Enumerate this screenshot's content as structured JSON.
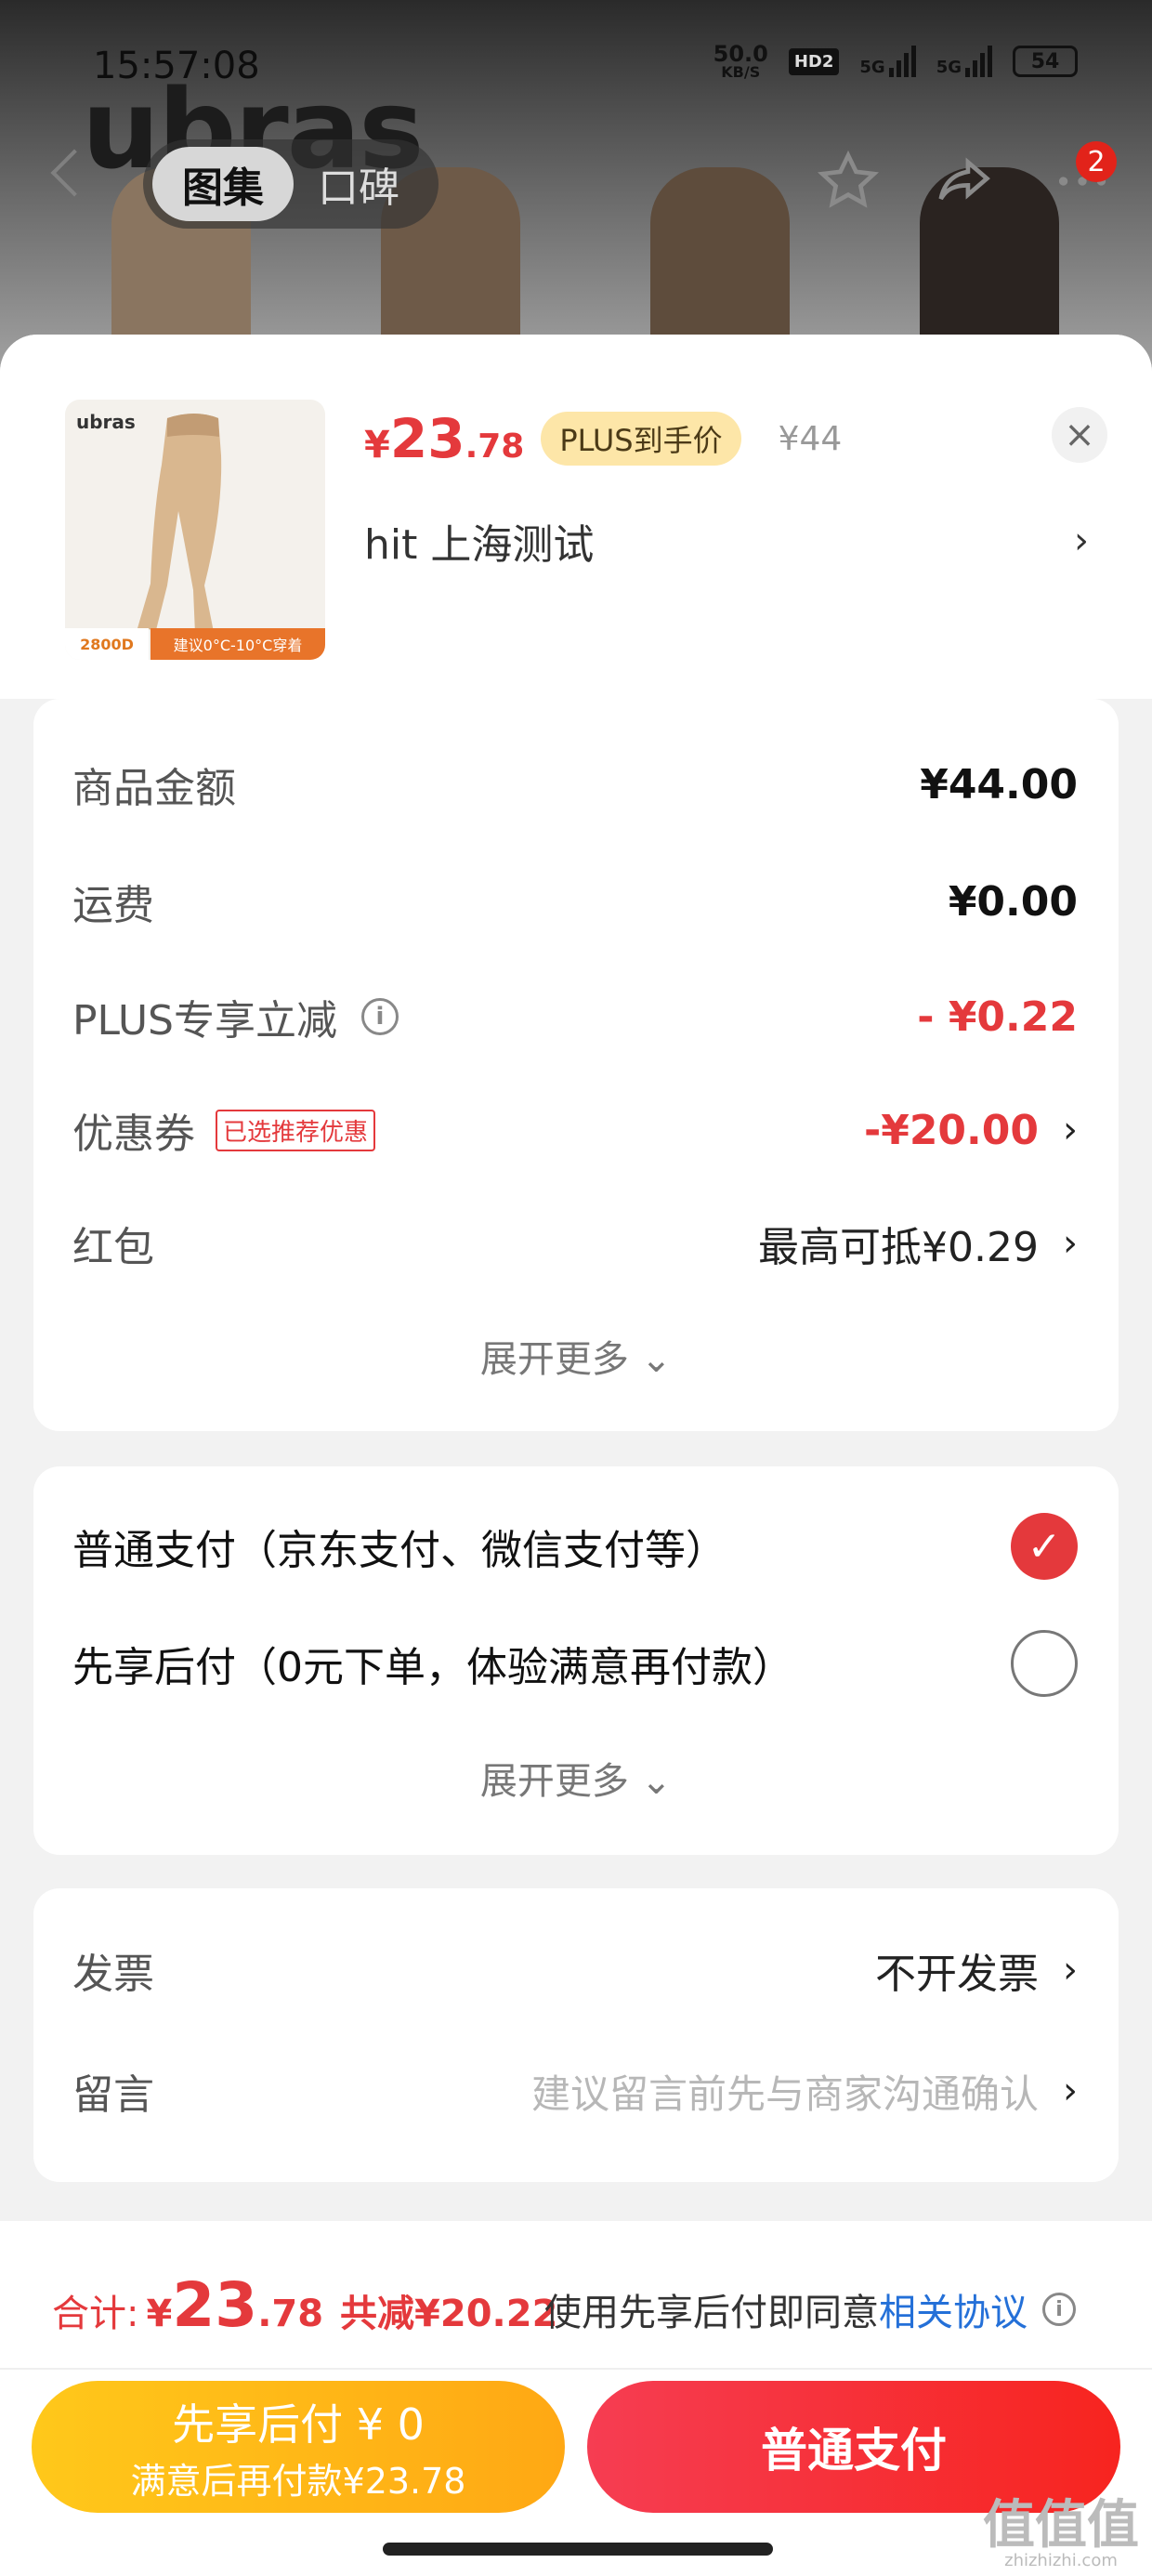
{
  "status_bar": {
    "time": "15:57:08",
    "net_speed": "50.0",
    "net_unit": "KB/S",
    "hd_label": "HD2",
    "sig1_label": "5G",
    "sig2_label": "5G",
    "battery": "54"
  },
  "background": {
    "brand": "ubras"
  },
  "nav": {
    "tab_gallery": "图集",
    "tab_reviews": "口碑",
    "cart_count": "2"
  },
  "product": {
    "image_brand": "ubras",
    "image_tag1": "2800D",
    "image_tag2": "建议0°C-10°C穿着",
    "price_currency": "¥",
    "price_int": "23",
    "price_dec": ".78",
    "plus_badge": "PLUS到手价",
    "original_price": "¥44",
    "spec": "hit  上海测试",
    "close_label": "×"
  },
  "cost_breakdown": {
    "items": [
      {
        "label": "商品金额",
        "value": "¥44.00"
      },
      {
        "label": "运费",
        "value": "¥0.00"
      },
      {
        "label": "PLUS专享立减",
        "value": "- ¥0.22"
      },
      {
        "label": "优惠券",
        "tag": "已选推荐优惠",
        "value": "-¥20.00"
      },
      {
        "label": "红包",
        "value": "最高可抵¥0.29"
      }
    ],
    "expand_label": "展开更多"
  },
  "payment": {
    "options": [
      {
        "label": "普通支付（京东支付、微信支付等）",
        "selected": true
      },
      {
        "label": "先享后付（0元下单，体验满意再付款）",
        "selected": false
      }
    ],
    "expand_label": "展开更多"
  },
  "extras": {
    "invoice_label": "发票",
    "invoice_value": "不开发票",
    "message_label": "留言",
    "message_placeholder": "建议留言前先与商家沟通确认"
  },
  "summary": {
    "total_label": "合计:",
    "currency": "¥",
    "total_int": "23",
    "total_dec": ".78",
    "saved": "共减¥20.22",
    "agree_text": "使用先享后付即同意",
    "agree_link": "相关协议"
  },
  "buttons": {
    "pay_later_title": "先享后付 ¥ 0",
    "pay_later_sub": "满意后再付款¥23.78",
    "pay_now": "普通支付"
  },
  "watermark": {
    "main": "值值值",
    "sub": "zhizhizhi.com"
  },
  "colors": {
    "accent_red": "#e4393c",
    "plus_gold": "#fde6a8",
    "pay_later_yellow": "#ffb814",
    "link_blue": "#2470d8"
  }
}
